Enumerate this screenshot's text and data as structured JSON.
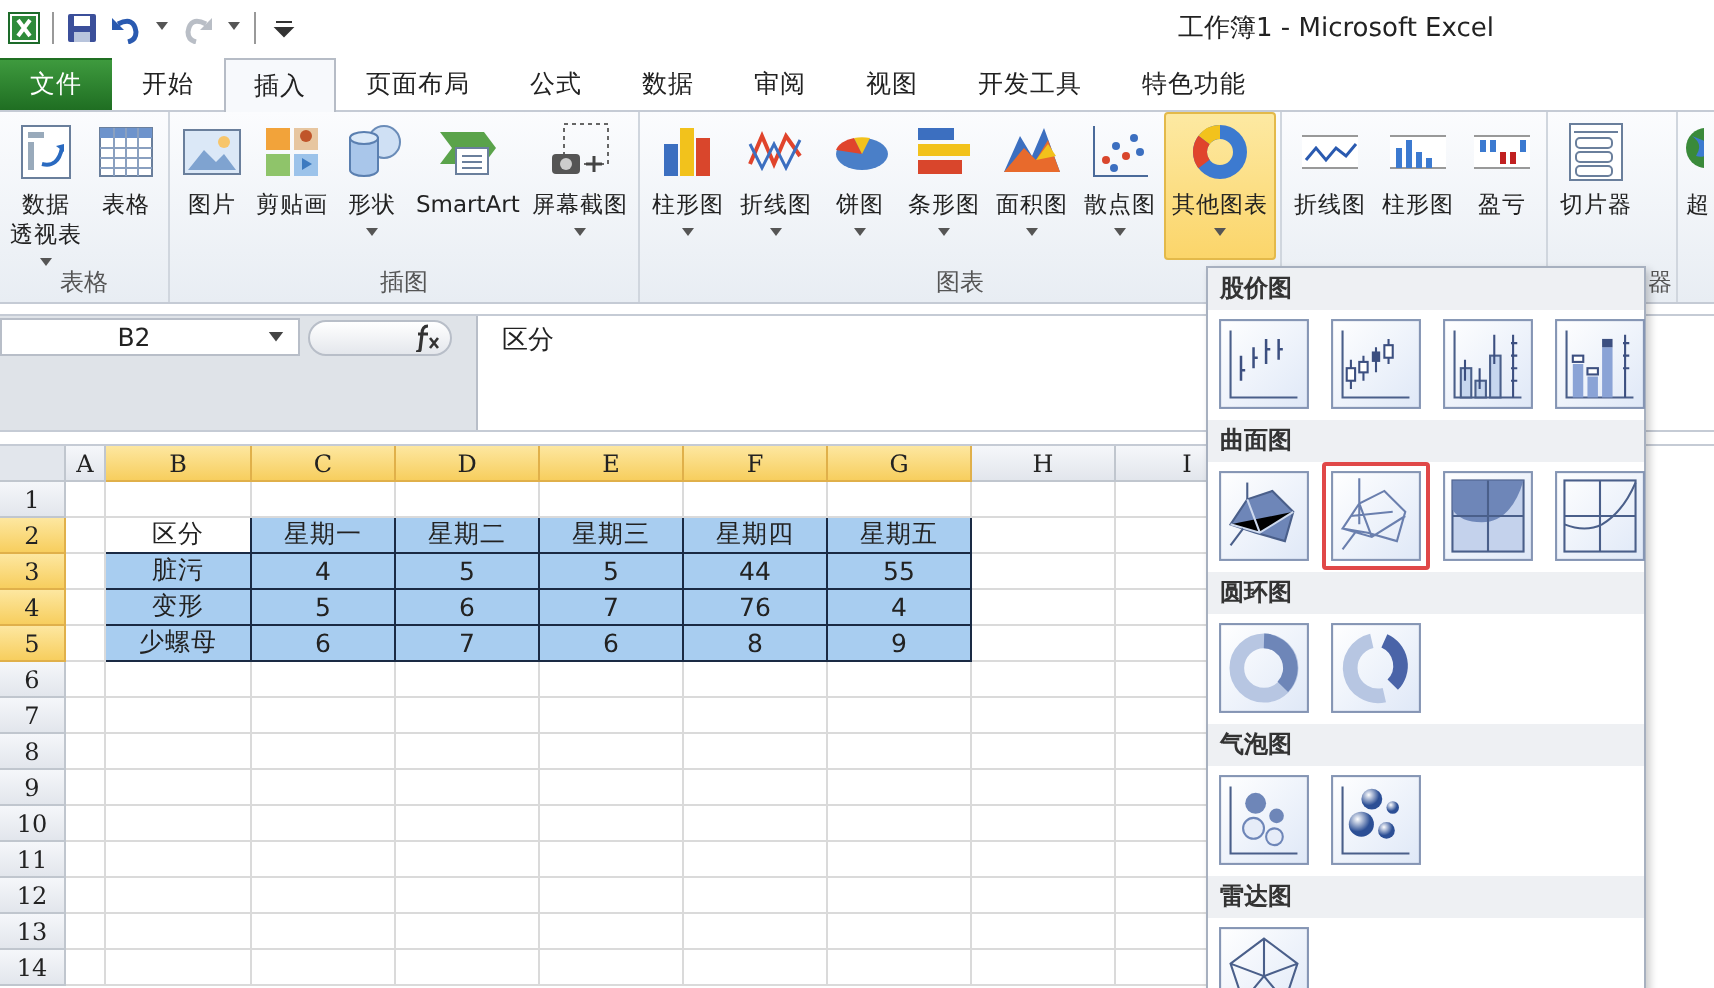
{
  "title_bar": {
    "title": "工作簿1  -  Microsoft Excel"
  },
  "tabs": [
    {
      "label": "文件",
      "kind": "file",
      "selected": false
    },
    {
      "label": "开始",
      "kind": "tab",
      "selected": false
    },
    {
      "label": "插入",
      "kind": "tab",
      "selected": true
    },
    {
      "label": "页面布局",
      "kind": "tab",
      "selected": false
    },
    {
      "label": "公式",
      "kind": "tab",
      "selected": false
    },
    {
      "label": "数据",
      "kind": "tab",
      "selected": false
    },
    {
      "label": "审阅",
      "kind": "tab",
      "selected": false
    },
    {
      "label": "视图",
      "kind": "tab",
      "selected": false
    },
    {
      "label": "开发工具",
      "kind": "tab",
      "selected": false
    },
    {
      "label": "特色功能",
      "kind": "tab",
      "selected": false
    }
  ],
  "ribbon": {
    "groups": [
      {
        "label": "表格",
        "buttons": [
          {
            "label_lines": [
              "数据",
              "透视表"
            ],
            "kind": "pivot",
            "dropdown": true,
            "selected": false
          },
          {
            "label_lines": [
              "表格"
            ],
            "kind": "table",
            "dropdown": false,
            "selected": false
          }
        ]
      },
      {
        "label": "插图",
        "buttons": [
          {
            "label_lines": [
              "图片"
            ],
            "kind": "picture",
            "dropdown": false,
            "selected": false
          },
          {
            "label_lines": [
              "剪贴画"
            ],
            "kind": "clipart",
            "dropdown": false,
            "selected": false
          },
          {
            "label_lines": [
              "形状"
            ],
            "kind": "shapes",
            "dropdown": true,
            "selected": false
          },
          {
            "label_lines": [
              "SmartArt"
            ],
            "kind": "smartart",
            "dropdown": false,
            "selected": false
          },
          {
            "label_lines": [
              "屏幕截图"
            ],
            "kind": "screenshot",
            "dropdown": true,
            "selected": false
          }
        ]
      },
      {
        "label": "图表",
        "buttons": [
          {
            "label_lines": [
              "柱形图"
            ],
            "kind": "column",
            "dropdown": true,
            "selected": false
          },
          {
            "label_lines": [
              "折线图"
            ],
            "kind": "line",
            "dropdown": true,
            "selected": false
          },
          {
            "label_lines": [
              "饼图"
            ],
            "kind": "pie",
            "dropdown": true,
            "selected": false
          },
          {
            "label_lines": [
              "条形图"
            ],
            "kind": "bar",
            "dropdown": true,
            "selected": false
          },
          {
            "label_lines": [
              "面积图"
            ],
            "kind": "area",
            "dropdown": true,
            "selected": false
          },
          {
            "label_lines": [
              "散点图"
            ],
            "kind": "scatter",
            "dropdown": true,
            "selected": false
          },
          {
            "label_lines": [
              "其他图表"
            ],
            "kind": "other",
            "dropdown": true,
            "selected": true
          }
        ]
      },
      {
        "buttons": [
          {
            "label_lines": [
              "折线图"
            ],
            "kind": "sparkline",
            "dropdown": false,
            "selected": false
          },
          {
            "label_lines": [
              "柱形图"
            ],
            "kind": "sparkcolumn",
            "dropdown": false,
            "selected": false
          },
          {
            "label_lines": [
              "盈亏"
            ],
            "kind": "winloss",
            "dropdown": false,
            "selected": false
          }
        ]
      },
      {
        "label": "器",
        "buttons": [
          {
            "label_lines": [
              "切片器"
            ],
            "kind": "slicer",
            "dropdown": false,
            "selected": false
          }
        ]
      },
      {
        "buttons": [
          {
            "label_lines": [
              "超"
            ],
            "kind": "globe",
            "dropdown": false,
            "selected": false
          }
        ]
      }
    ]
  },
  "formula_bar": {
    "name_box": "B2",
    "formula": "区分"
  },
  "sheet": {
    "columns": [
      {
        "label": "A",
        "selected": false
      },
      {
        "label": "B",
        "selected": true
      },
      {
        "label": "C",
        "selected": true
      },
      {
        "label": "D",
        "selected": true
      },
      {
        "label": "E",
        "selected": true
      },
      {
        "label": "F",
        "selected": true
      },
      {
        "label": "G",
        "selected": true
      },
      {
        "label": "H",
        "selected": false
      },
      {
        "label": "I",
        "selected": false
      }
    ],
    "rows": [
      {
        "label": "1",
        "selected": false
      },
      {
        "label": "2",
        "selected": true,
        "cells": [
          {
            "text": "区分",
            "active": true
          },
          {
            "text": "星期一",
            "active": false
          },
          {
            "text": "星期二",
            "active": false
          },
          {
            "text": "星期三",
            "active": false
          },
          {
            "text": "星期四",
            "active": false
          },
          {
            "text": "星期五",
            "active": false
          }
        ]
      },
      {
        "label": "3",
        "selected": true,
        "cells": [
          {
            "text": "脏污",
            "active": false
          },
          {
            "text": "4",
            "active": false
          },
          {
            "text": "5",
            "active": false
          },
          {
            "text": "5",
            "active": false
          },
          {
            "text": "44",
            "active": false
          },
          {
            "text": "55",
            "active": false
          }
        ]
      },
      {
        "label": "4",
        "selected": true,
        "cells": [
          {
            "text": "变形",
            "active": false
          },
          {
            "text": "5",
            "active": false
          },
          {
            "text": "6",
            "active": false
          },
          {
            "text": "7",
            "active": false
          },
          {
            "text": "76",
            "active": false
          },
          {
            "text": "4",
            "active": false
          }
        ]
      },
      {
        "label": "5",
        "selected": true,
        "cells": [
          {
            "text": "少螺母",
            "active": false
          },
          {
            "text": "6",
            "active": false
          },
          {
            "text": "7",
            "active": false
          },
          {
            "text": "6",
            "active": false
          },
          {
            "text": "8",
            "active": false
          },
          {
            "text": "9",
            "active": false
          }
        ]
      },
      {
        "label": "6",
        "selected": false
      },
      {
        "label": "7",
        "selected": false
      },
      {
        "label": "8",
        "selected": false
      },
      {
        "label": "9",
        "selected": false
      },
      {
        "label": "10",
        "selected": false
      },
      {
        "label": "11",
        "selected": false
      },
      {
        "label": "12",
        "selected": false
      },
      {
        "label": "13",
        "selected": false
      },
      {
        "label": "14",
        "selected": false
      }
    ]
  },
  "chart_menu": {
    "sections": [
      {
        "title": "股价图",
        "items": [
          {
            "kind": "hlc",
            "selected": false
          },
          {
            "kind": "ohlc",
            "selected": false
          },
          {
            "kind": "vhlc",
            "selected": false
          },
          {
            "kind": "vohlc",
            "selected": false
          }
        ]
      },
      {
        "title": "曲面图",
        "items": [
          {
            "kind": "surface",
            "selected": false
          },
          {
            "kind": "wireframe",
            "selected": true
          },
          {
            "kind": "contour",
            "selected": false
          },
          {
            "kind": "wirecontour",
            "selected": false
          }
        ]
      },
      {
        "title": "圆环图",
        "items": [
          {
            "kind": "doughnut",
            "selected": false
          },
          {
            "kind": "exploded",
            "selected": false
          }
        ]
      },
      {
        "title": "气泡图",
        "items": [
          {
            "kind": "bubble",
            "selected": false
          },
          {
            "kind": "bubble3d",
            "selected": false
          }
        ]
      },
      {
        "title": "雷达图",
        "items": [
          {
            "kind": "radar",
            "selected": false
          }
        ]
      }
    ]
  }
}
